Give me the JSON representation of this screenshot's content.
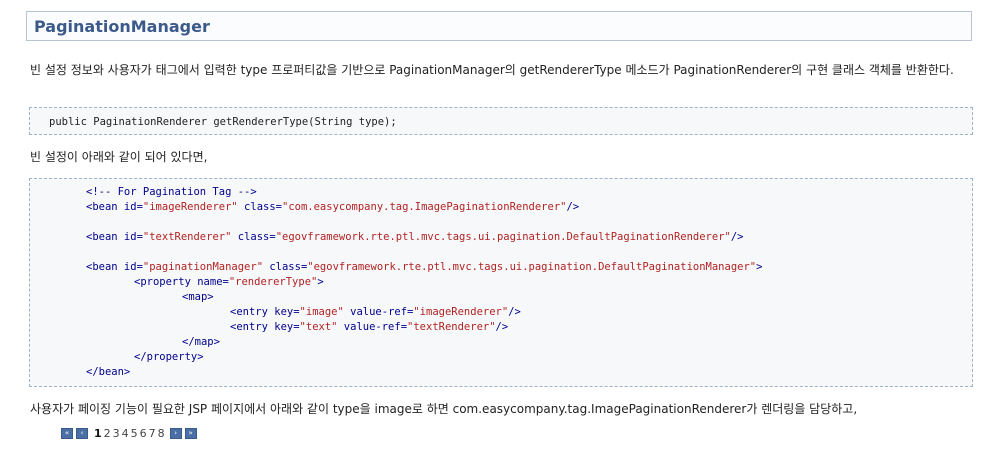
{
  "title": "PaginationManager",
  "paragraphs": {
    "intro": "빈 설정 정보와 사용자가 태그에서 입력한 type 프로퍼티값을 기반으로 PaginationManager의 getRendererType 메소드가 PaginationRenderer의 구현 클래스 객체를 반환한다.",
    "config": "빈 설정이 아래와 같이 되어 있다면,",
    "usage": "사용자가 페이징 기능이 필요한 JSP 페이지에서 아래와 같이 type을 image로 하면 com.easycompany.tag.ImagePaginationRenderer가 렌더링을 담당하고,"
  },
  "code_signature": "public PaginationRenderer getRendererType(String type);",
  "xml": {
    "comment": "<!-- For Pagination Tag -->",
    "bean_open": "<bean",
    "bean_close": "</bean>",
    "property_open": "<property",
    "property_close": "</property>",
    "map_open": "<map>",
    "map_close": "</map>",
    "entry_open": "<entry",
    "attr_id": " id=",
    "attr_class": " class=",
    "attr_name": " name=",
    "attr_key": " key=",
    "attr_valueref": " value-ref=",
    "end_self": "/>",
    "end_tag": ">",
    "bean1_id": "\"imageRenderer\"",
    "bean1_class": "\"com.easycompany.tag.ImagePaginationRenderer\"",
    "bean2_id": "\"textRenderer\"",
    "bean2_class": "\"egovframework.rte.ptl.mvc.tags.ui.pagination.DefaultPaginationRenderer\"",
    "bean3_id": "\"paginationManager\"",
    "bean3_class": "\"egovframework.rte.ptl.mvc.tags.ui.pagination.DefaultPaginationManager\"",
    "prop_name": "\"rendererType\"",
    "entry1_key": "\"image\"",
    "entry1_ref": "\"imageRenderer\"",
    "entry2_key": "\"text\"",
    "entry2_ref": "\"textRenderer\""
  },
  "pager": {
    "first": "«",
    "prev": "‹",
    "next": "›",
    "last": "»",
    "pages": [
      "1",
      "2",
      "3",
      "4",
      "5",
      "6",
      "7",
      "8"
    ],
    "current": "1"
  }
}
